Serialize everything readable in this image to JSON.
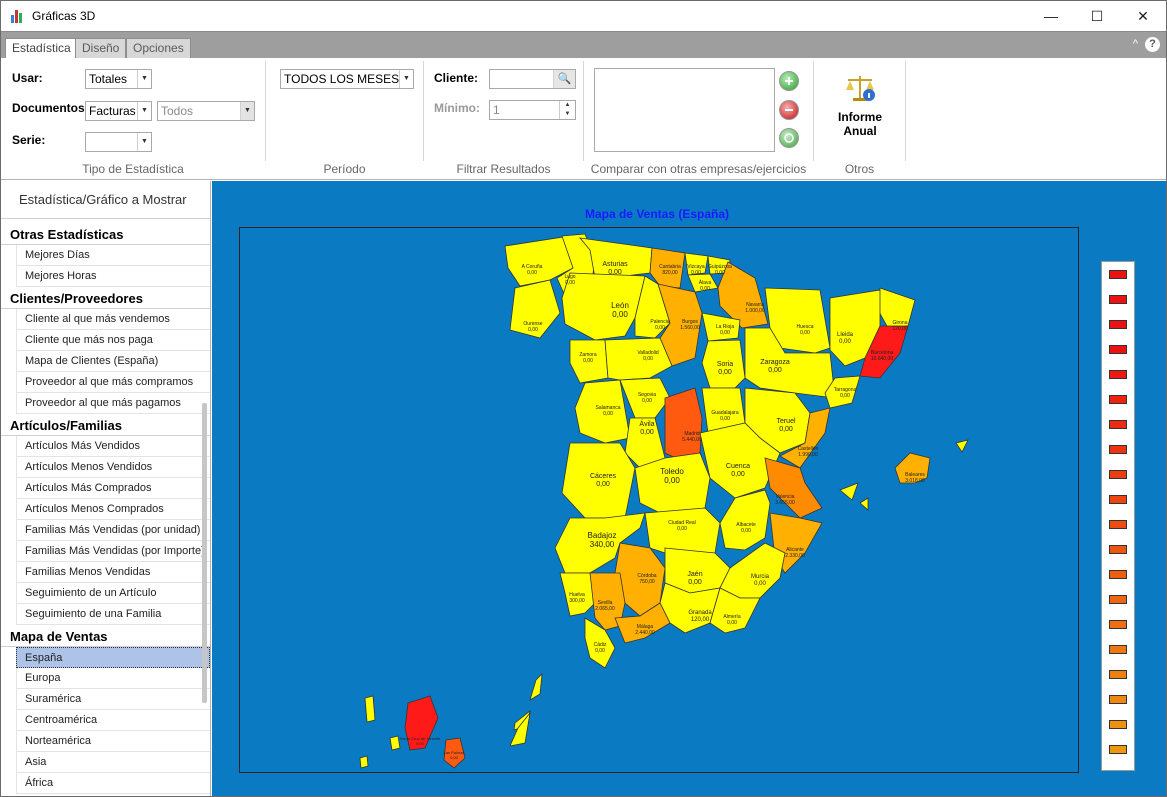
{
  "window": {
    "title": "Gráficas 3D",
    "minimize": "—",
    "maximize": "☐",
    "close": "✕"
  },
  "tabs": [
    {
      "label": "Estadística"
    },
    {
      "label": "Diseño"
    },
    {
      "label": "Opciones"
    }
  ],
  "ribbon": {
    "collapse_icon": "^",
    "help_icon": "?",
    "usar_label": "Usar:",
    "usar_value": "Totales",
    "documentos_label": "Documentos:",
    "documentos_value": "Facturas",
    "documentos_filter": "Todos",
    "serie_label": "Serie:",
    "serie_value": "",
    "group_tipo": "Tipo de Estadística",
    "periodo_value": "TODOS LOS MESES",
    "group_periodo": "Período",
    "cliente_label": "Cliente:",
    "cliente_value": "",
    "minimo_label": "Mínimo:",
    "minimo_value": "1",
    "group_filtrar": "Filtrar Resultados",
    "group_comparar": "Comparar con otras empresas/ejercicios",
    "informe_label_1": "Informe",
    "informe_label_2": "Anual",
    "group_otros": "Otros"
  },
  "sidebar": {
    "header": "Estadística/Gráfico   a Mostrar",
    "sections": [
      {
        "title": "Otras Estadísticas",
        "items": [
          "Mejores Días",
          "Mejores Horas"
        ]
      },
      {
        "title": "Clientes/Proveedores",
        "items": [
          "Cliente al que más vendemos",
          "Cliente que más nos paga",
          "Mapa de Clientes (España)",
          "Proveedor al que más compramos",
          "Proveedor al que más pagamos"
        ]
      },
      {
        "title": "Artículos/Familias",
        "items": [
          "Artículos Más Vendidos",
          "Artículos Menos Vendidos",
          "Artículos Más Comprados",
          "Artículos Menos Comprados",
          "Familias Más Vendidas (por unidad)",
          "Familias Más Vendidas (por Importe)",
          "Familias Menos Vendidas",
          "Seguimiento de un Artículo",
          "Seguimiento de una Familia"
        ]
      },
      {
        "title": "Mapa de Ventas",
        "items": [
          "España",
          "Europa",
          "Suramérica",
          "Centroamérica",
          "Norteamérica",
          "Asia",
          "África"
        ]
      }
    ],
    "selected_item": "España"
  },
  "map": {
    "title": "Mapa de Ventas (España)",
    "colors": {
      "yellow": "#ffff00",
      "light_orange": "#ffb000",
      "orange": "#ff8c00",
      "dark_orange": "#ff5a10",
      "red": "#ff1a1a"
    },
    "provinces": [
      {
        "name": "A Coruña",
        "value": "0,00"
      },
      {
        "name": "Lugo",
        "value": "0,00"
      },
      {
        "name": "Asturias",
        "value": "0,00"
      },
      {
        "name": "Cantabria",
        "value": "820,00"
      },
      {
        "name": "Vizcaya",
        "value": "0,00"
      },
      {
        "name": "Guipúzcoa",
        "value": "0,00"
      },
      {
        "name": "Álava",
        "value": "0,00"
      },
      {
        "name": "Navarra",
        "value": "1.000,00"
      },
      {
        "name": "Huesca",
        "value": "0,00"
      },
      {
        "name": "Girona",
        "value": "120,00"
      },
      {
        "name": "Lleida",
        "value": "0,00"
      },
      {
        "name": "Barcelona",
        "value": "10.640,00"
      },
      {
        "name": "Ourense",
        "value": "0,00"
      },
      {
        "name": "León",
        "value": "0,00"
      },
      {
        "name": "Palencia",
        "value": "0,00"
      },
      {
        "name": "Burgos",
        "value": "1.560,00"
      },
      {
        "name": "La Rioja",
        "value": "0,00"
      },
      {
        "name": "Zamora",
        "value": "0,00"
      },
      {
        "name": "Valladolid",
        "value": "0,00"
      },
      {
        "name": "Soria",
        "value": "0,00"
      },
      {
        "name": "Zaragoza",
        "value": "0,00"
      },
      {
        "name": "Tarragona",
        "value": "0,00"
      },
      {
        "name": "Salamanca",
        "value": "0,00"
      },
      {
        "name": "Segovia",
        "value": "0,00"
      },
      {
        "name": "Ávila",
        "value": "0,00"
      },
      {
        "name": "Madrid",
        "value": "5.440,00"
      },
      {
        "name": "Guadalajara",
        "value": "0,00"
      },
      {
        "name": "Teruel",
        "value": "0,00"
      },
      {
        "name": "Castellón",
        "value": "1.990,00"
      },
      {
        "name": "Baleares",
        "value": "3.018,00"
      },
      {
        "name": "Cáceres",
        "value": "0,00"
      },
      {
        "name": "Toledo",
        "value": "0,00"
      },
      {
        "name": "Cuenca",
        "value": "0,00"
      },
      {
        "name": "Valencia",
        "value": "3.655,00"
      },
      {
        "name": "Badajoz",
        "value": "340,00"
      },
      {
        "name": "Ciudad Real",
        "value": "0,00"
      },
      {
        "name": "Albacete",
        "value": "0,00"
      },
      {
        "name": "Alicante",
        "value": "2.330,00"
      },
      {
        "name": "Córdoba",
        "value": "750,00"
      },
      {
        "name": "Jaén",
        "value": "0,00"
      },
      {
        "name": "Murcia",
        "value": "0,00"
      },
      {
        "name": "Huelva",
        "value": "300,00"
      },
      {
        "name": "Sevilla",
        "value": "2.065,00"
      },
      {
        "name": "Granada",
        "value": "120,00"
      },
      {
        "name": "Almería",
        "value": "0,00"
      },
      {
        "name": "Cádiz",
        "value": "0,00"
      },
      {
        "name": "Málaga",
        "value": "2.440,00"
      },
      {
        "name": "Santa Cruz de Tenerife",
        "value": "0,00"
      },
      {
        "name": "Las Palmas",
        "value": "0,00"
      }
    ],
    "legend_colors": [
      "#ee1111",
      "#ee1111",
      "#ee1111",
      "#ee1111",
      "#ee1a11",
      "#ee2211",
      "#ee2a11",
      "#ee3311",
      "#ee3c11",
      "#ee4411",
      "#ee4c11",
      "#ee5511",
      "#ee5d11",
      "#ee6611",
      "#ee6e11",
      "#ee7711",
      "#ee7f11",
      "#ee8811",
      "#ee9011",
      "#ee9811"
    ]
  }
}
